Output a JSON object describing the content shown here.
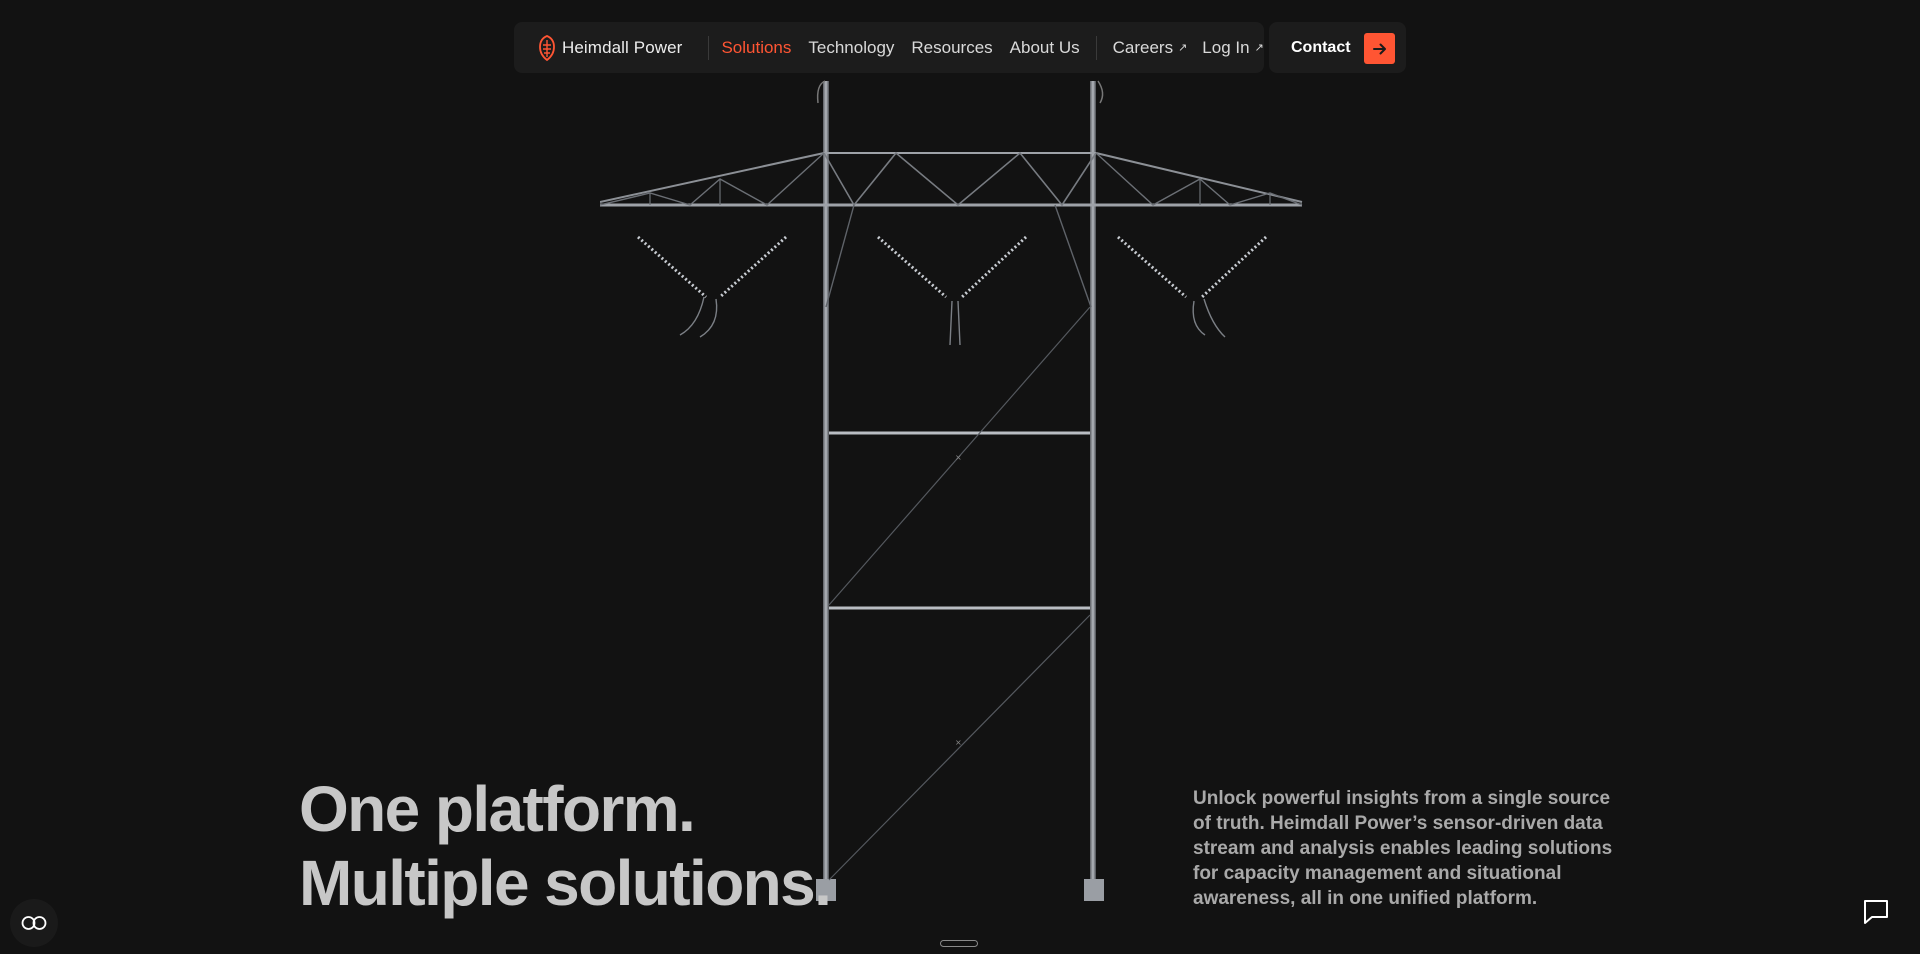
{
  "brand": {
    "name": "Heimdall Power",
    "accent_color": "#ff5533"
  },
  "nav": {
    "links": [
      {
        "label": "Solutions",
        "active": true
      },
      {
        "label": "Technology",
        "active": false
      },
      {
        "label": "Resources",
        "active": false
      },
      {
        "label": "About Us",
        "active": false
      }
    ],
    "external": [
      {
        "label": "Careers",
        "icon": "external-arrow-icon"
      },
      {
        "label": "Log In",
        "icon": "external-arrow-icon"
      }
    ],
    "contact": {
      "label": "Contact",
      "icon": "arrow-right-icon"
    }
  },
  "hero": {
    "headline_line1": "One platform.",
    "headline_line2": "Multiple solutions.",
    "description": "Unlock powerful insights from a single source of truth. Heimdall Power’s sensor-driven data stream and analysis enables leading solutions for capacity management and situational awareness, all in one unified platform.",
    "image": "transmission-tower"
  },
  "widgets": {
    "cookie_icon": "cookie-settings-icon",
    "chat_icon": "chat-icon"
  }
}
